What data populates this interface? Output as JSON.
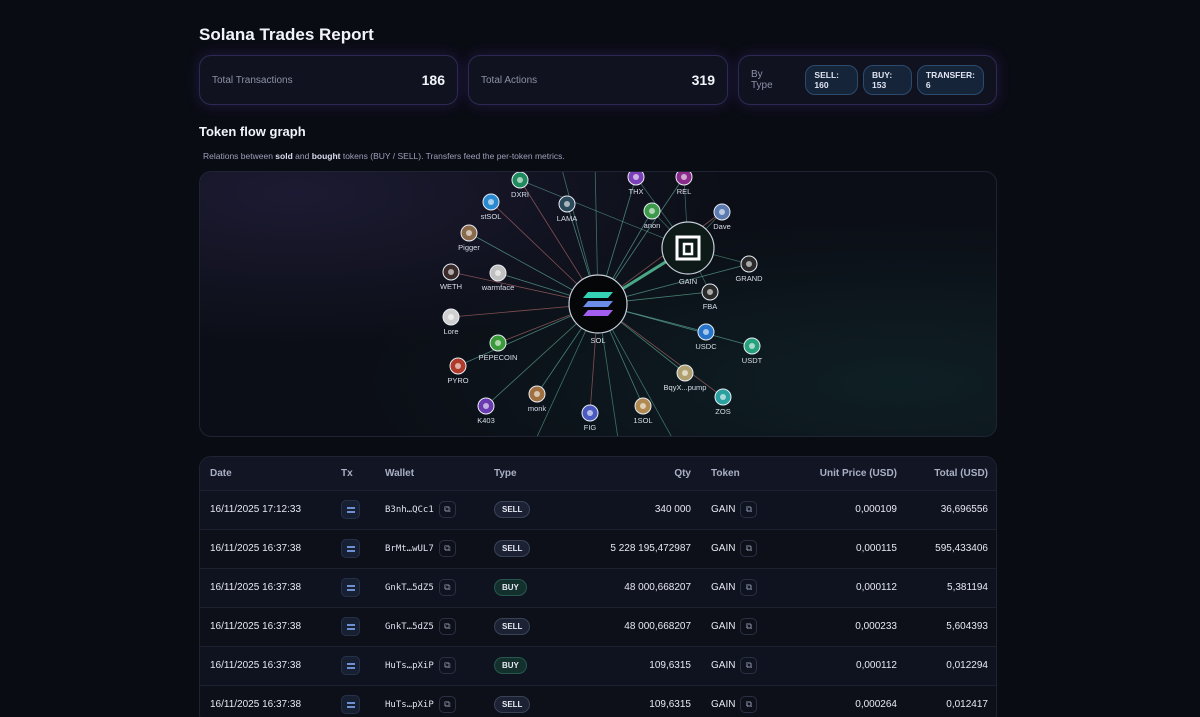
{
  "title": "Solana Trades Report",
  "stats": {
    "total_transactions": {
      "label": "Total Transactions",
      "value": "186"
    },
    "total_actions": {
      "label": "Total Actions",
      "value": "319"
    },
    "by_type": {
      "label": "By Type",
      "chips": [
        "SELL: 160",
        "BUY: 153",
        "TRANSFER: 6"
      ]
    }
  },
  "graph_section": {
    "title": "Token flow graph",
    "sub_prefix": "Relations between ",
    "sub_sold": "sold",
    "sub_and": " and ",
    "sub_bought": "bought",
    "sub_suffix": " tokens (BUY / SELL). Transfers feed the per-token metrics.",
    "center": {
      "label": "SOL"
    },
    "hub": {
      "label": "GAIN"
    },
    "nodes": [
      {
        "label": "DXRI",
        "color": "#1f8a5c"
      },
      {
        "label": "THX",
        "color": "#7b3fb8"
      },
      {
        "label": "REL",
        "color": "#8a2a8a"
      },
      {
        "label": "stSOL",
        "color": "#2a8ad0"
      },
      {
        "label": "LAMA",
        "color": "#2b4a5c"
      },
      {
        "label": "anon",
        "color": "#3d9a4a"
      },
      {
        "label": "Dave",
        "color": "#5a7ab0"
      },
      {
        "label": "Pigger",
        "color": "#8a6a4a"
      },
      {
        "label": "GRAND",
        "color": "#2a2a2a"
      },
      {
        "label": "WETH",
        "color": "#3a2a2a"
      },
      {
        "label": "warmface",
        "color": "#c0c0c0"
      },
      {
        "label": "FBA",
        "color": "#2a2a2a"
      },
      {
        "label": "Lore",
        "color": "#d0d0d0"
      },
      {
        "label": "USDC",
        "color": "#2775ca"
      },
      {
        "label": "USDT",
        "color": "#26a17b"
      },
      {
        "label": "PEPECOIN",
        "color": "#3a9a3a"
      },
      {
        "label": "PYRO",
        "color": "#b03a2a"
      },
      {
        "label": "BqyX...pump",
        "color": "#b0a070"
      },
      {
        "label": "ZOS",
        "color": "#2aa0a0"
      },
      {
        "label": "monk",
        "color": "#a07040"
      },
      {
        "label": "K403",
        "color": "#6a3ab0"
      },
      {
        "label": "FIG",
        "color": "#4a5ac0"
      },
      {
        "label": "1SOL",
        "color": "#b08a50"
      }
    ]
  },
  "table": {
    "headers": [
      "Date",
      "Tx",
      "Wallet",
      "Type",
      "Qty",
      "Token",
      "Unit Price (USD)",
      "Total (USD)"
    ],
    "rows": [
      {
        "date": "16/11/2025 17:12:33",
        "wallet": "B3nh…QCc1",
        "type": "SELL",
        "qty": "340 000",
        "token": "GAIN",
        "unit_price": "0,000109",
        "total": "36,696556"
      },
      {
        "date": "16/11/2025 16:37:38",
        "wallet": "BrMt…wUL7",
        "type": "SELL",
        "qty": "5 228 195,472987",
        "token": "GAIN",
        "unit_price": "0,000115",
        "total": "595,433406"
      },
      {
        "date": "16/11/2025 16:37:38",
        "wallet": "GnkT…5dZ5",
        "type": "BUY",
        "qty": "48 000,668207",
        "token": "GAIN",
        "unit_price": "0,000112",
        "total": "5,381194"
      },
      {
        "date": "16/11/2025 16:37:38",
        "wallet": "GnkT…5dZ5",
        "type": "SELL",
        "qty": "48 000,668207",
        "token": "GAIN",
        "unit_price": "0,000233",
        "total": "5,604393"
      },
      {
        "date": "16/11/2025 16:37:38",
        "wallet": "HuTs…pXiP",
        "type": "BUY",
        "qty": "109,6315",
        "token": "GAIN",
        "unit_price": "0,000112",
        "total": "0,012294"
      },
      {
        "date": "16/11/2025 16:37:38",
        "wallet": "HuTs…pXiP",
        "type": "SELL",
        "qty": "109,6315",
        "token": "GAIN",
        "unit_price": "0,000264",
        "total": "0,012417"
      }
    ]
  }
}
